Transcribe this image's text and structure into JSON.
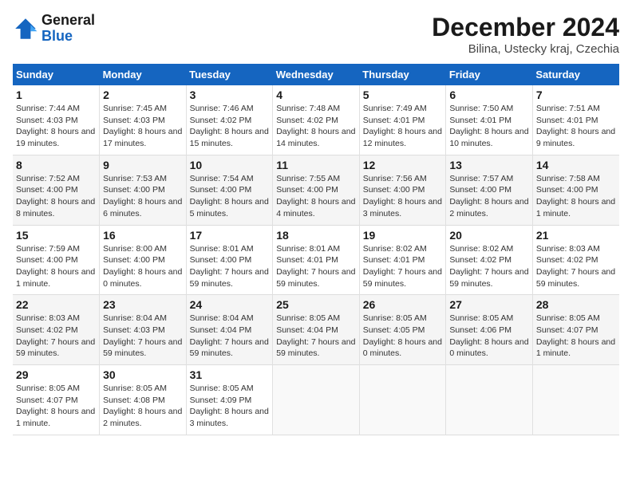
{
  "header": {
    "logo_line1": "General",
    "logo_line2": "Blue",
    "month": "December 2024",
    "location": "Bilina, Ustecky kraj, Czechia"
  },
  "weekdays": [
    "Sunday",
    "Monday",
    "Tuesday",
    "Wednesday",
    "Thursday",
    "Friday",
    "Saturday"
  ],
  "weeks": [
    [
      {
        "day": "1",
        "info": "Sunrise: 7:44 AM\nSunset: 4:03 PM\nDaylight: 8 hours and 19 minutes."
      },
      {
        "day": "2",
        "info": "Sunrise: 7:45 AM\nSunset: 4:03 PM\nDaylight: 8 hours and 17 minutes."
      },
      {
        "day": "3",
        "info": "Sunrise: 7:46 AM\nSunset: 4:02 PM\nDaylight: 8 hours and 15 minutes."
      },
      {
        "day": "4",
        "info": "Sunrise: 7:48 AM\nSunset: 4:02 PM\nDaylight: 8 hours and 14 minutes."
      },
      {
        "day": "5",
        "info": "Sunrise: 7:49 AM\nSunset: 4:01 PM\nDaylight: 8 hours and 12 minutes."
      },
      {
        "day": "6",
        "info": "Sunrise: 7:50 AM\nSunset: 4:01 PM\nDaylight: 8 hours and 10 minutes."
      },
      {
        "day": "7",
        "info": "Sunrise: 7:51 AM\nSunset: 4:01 PM\nDaylight: 8 hours and 9 minutes."
      }
    ],
    [
      {
        "day": "8",
        "info": "Sunrise: 7:52 AM\nSunset: 4:00 PM\nDaylight: 8 hours and 8 minutes."
      },
      {
        "day": "9",
        "info": "Sunrise: 7:53 AM\nSunset: 4:00 PM\nDaylight: 8 hours and 6 minutes."
      },
      {
        "day": "10",
        "info": "Sunrise: 7:54 AM\nSunset: 4:00 PM\nDaylight: 8 hours and 5 minutes."
      },
      {
        "day": "11",
        "info": "Sunrise: 7:55 AM\nSunset: 4:00 PM\nDaylight: 8 hours and 4 minutes."
      },
      {
        "day": "12",
        "info": "Sunrise: 7:56 AM\nSunset: 4:00 PM\nDaylight: 8 hours and 3 minutes."
      },
      {
        "day": "13",
        "info": "Sunrise: 7:57 AM\nSunset: 4:00 PM\nDaylight: 8 hours and 2 minutes."
      },
      {
        "day": "14",
        "info": "Sunrise: 7:58 AM\nSunset: 4:00 PM\nDaylight: 8 hours and 1 minute."
      }
    ],
    [
      {
        "day": "15",
        "info": "Sunrise: 7:59 AM\nSunset: 4:00 PM\nDaylight: 8 hours and 1 minute."
      },
      {
        "day": "16",
        "info": "Sunrise: 8:00 AM\nSunset: 4:00 PM\nDaylight: 8 hours and 0 minutes."
      },
      {
        "day": "17",
        "info": "Sunrise: 8:01 AM\nSunset: 4:00 PM\nDaylight: 7 hours and 59 minutes."
      },
      {
        "day": "18",
        "info": "Sunrise: 8:01 AM\nSunset: 4:01 PM\nDaylight: 7 hours and 59 minutes."
      },
      {
        "day": "19",
        "info": "Sunrise: 8:02 AM\nSunset: 4:01 PM\nDaylight: 7 hours and 59 minutes."
      },
      {
        "day": "20",
        "info": "Sunrise: 8:02 AM\nSunset: 4:02 PM\nDaylight: 7 hours and 59 minutes."
      },
      {
        "day": "21",
        "info": "Sunrise: 8:03 AM\nSunset: 4:02 PM\nDaylight: 7 hours and 59 minutes."
      }
    ],
    [
      {
        "day": "22",
        "info": "Sunrise: 8:03 AM\nSunset: 4:02 PM\nDaylight: 7 hours and 59 minutes."
      },
      {
        "day": "23",
        "info": "Sunrise: 8:04 AM\nSunset: 4:03 PM\nDaylight: 7 hours and 59 minutes."
      },
      {
        "day": "24",
        "info": "Sunrise: 8:04 AM\nSunset: 4:04 PM\nDaylight: 7 hours and 59 minutes."
      },
      {
        "day": "25",
        "info": "Sunrise: 8:05 AM\nSunset: 4:04 PM\nDaylight: 7 hours and 59 minutes."
      },
      {
        "day": "26",
        "info": "Sunrise: 8:05 AM\nSunset: 4:05 PM\nDaylight: 8 hours and 0 minutes."
      },
      {
        "day": "27",
        "info": "Sunrise: 8:05 AM\nSunset: 4:06 PM\nDaylight: 8 hours and 0 minutes."
      },
      {
        "day": "28",
        "info": "Sunrise: 8:05 AM\nSunset: 4:07 PM\nDaylight: 8 hours and 1 minute."
      }
    ],
    [
      {
        "day": "29",
        "info": "Sunrise: 8:05 AM\nSunset: 4:07 PM\nDaylight: 8 hours and 1 minute."
      },
      {
        "day": "30",
        "info": "Sunrise: 8:05 AM\nSunset: 4:08 PM\nDaylight: 8 hours and 2 minutes."
      },
      {
        "day": "31",
        "info": "Sunrise: 8:05 AM\nSunset: 4:09 PM\nDaylight: 8 hours and 3 minutes."
      },
      null,
      null,
      null,
      null
    ]
  ]
}
